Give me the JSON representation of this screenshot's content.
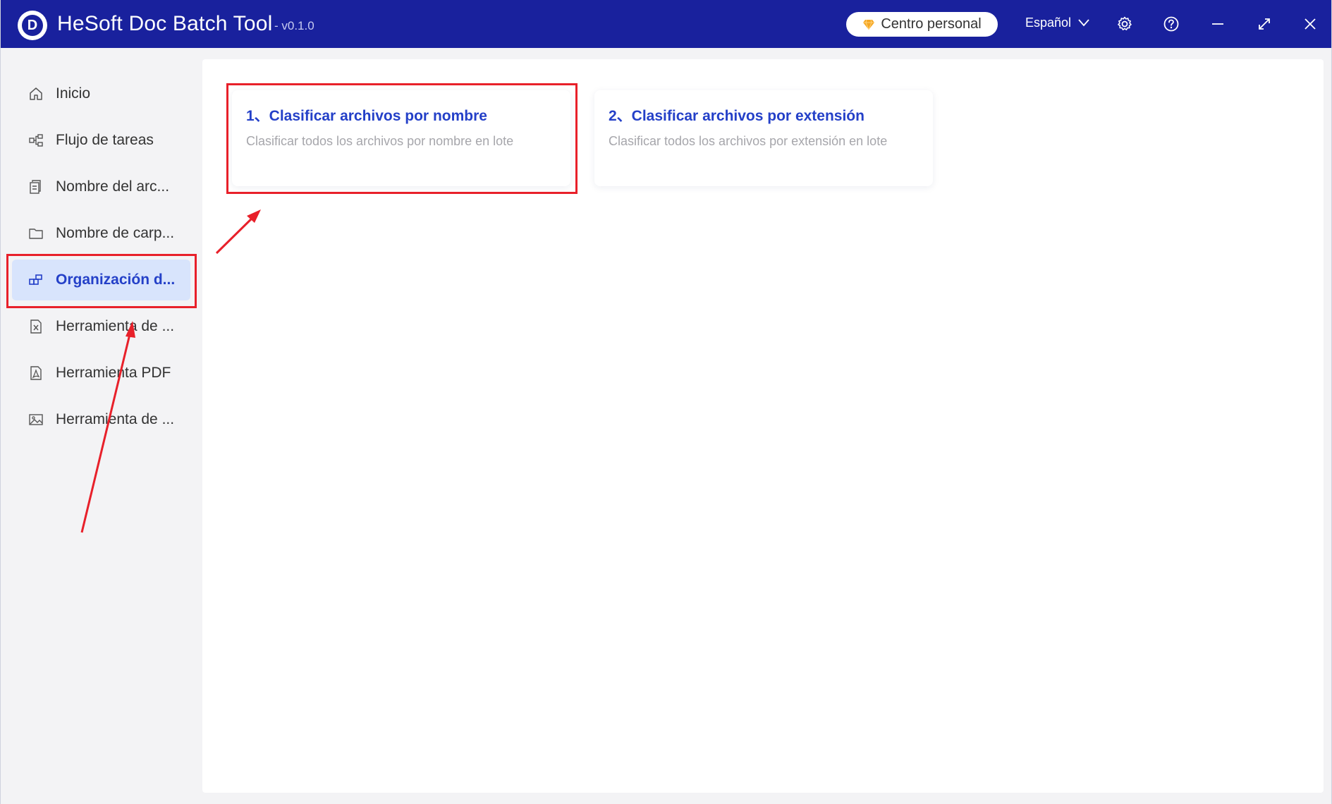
{
  "window": {
    "title": "HeSoft Doc Batch Tool",
    "version": "- v0.1.0",
    "logo_letter": "D"
  },
  "titlebar": {
    "personal_center": "Centro personal",
    "language": "Español",
    "icons": [
      "diamond-icon",
      "chevron-down-icon",
      "gear-icon",
      "help-icon",
      "minimize-icon",
      "maximize-icon",
      "close-icon"
    ]
  },
  "sidebar": {
    "items": [
      {
        "label": "Inicio",
        "icon": "home-icon",
        "active": false
      },
      {
        "label": "Flujo de tareas",
        "icon": "workflow-icon",
        "active": false
      },
      {
        "label": "Nombre del arc...",
        "icon": "file-name-icon",
        "active": false
      },
      {
        "label": "Nombre de carp...",
        "icon": "folder-icon",
        "active": false
      },
      {
        "label": "Organización d...",
        "icon": "organize-icon",
        "active": true
      },
      {
        "label": "Herramienta de ...",
        "icon": "excel-file-icon",
        "active": false
      },
      {
        "label": "Herramienta PDF",
        "icon": "pdf-file-icon",
        "active": false
      },
      {
        "label": "Herramienta de ...",
        "icon": "image-icon",
        "active": false
      }
    ]
  },
  "main": {
    "cards": [
      {
        "title": "1、Clasificar archivos por nombre",
        "description": "Clasificar todos los archivos por nombre en lote"
      },
      {
        "title": "2、Clasificar archivos por extensión",
        "description": "Clasificar todos los archivos por extensión en lote"
      }
    ]
  },
  "colors": {
    "titlebar_bg": "#19219d",
    "accent": "#2440c8",
    "active_nav_bg": "#d8e4fc",
    "annotation_red": "#e8202a"
  }
}
